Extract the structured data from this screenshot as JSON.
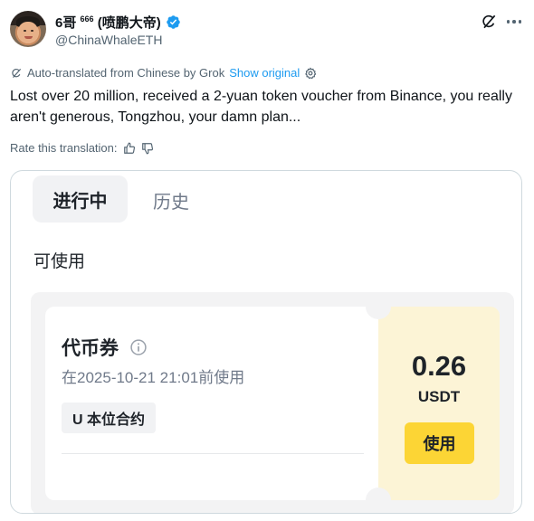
{
  "author": {
    "display_name": "6哥",
    "display_name_sup": "666",
    "display_name_suffix": "(喷鹏大帝)",
    "handle": "@ChinaWhaleETH",
    "verified": true
  },
  "translation": {
    "notice": "Auto-translated from Chinese by Grok",
    "show_original": "Show original"
  },
  "tweet": {
    "text": "Lost over 20 million, received a 2-yuan token voucher from Binance, you really aren't generous, Tongzhou, your damn plan..."
  },
  "rating": {
    "label": "Rate this translation:"
  },
  "media": {
    "tabs": [
      {
        "label": "进行中",
        "active": true
      },
      {
        "label": "历史",
        "active": false
      }
    ],
    "section_label": "可使用",
    "voucher": {
      "title": "代币券",
      "expiry": "在2025-10-21 21:01前使用",
      "tag": "U 本位合约",
      "amount": "0.26",
      "unit": "USDT",
      "button": "使用"
    }
  },
  "colors": {
    "accent": "#1d9bf0",
    "binance_yellow": "#fcd535",
    "voucher_side": "#fcf4d6"
  }
}
